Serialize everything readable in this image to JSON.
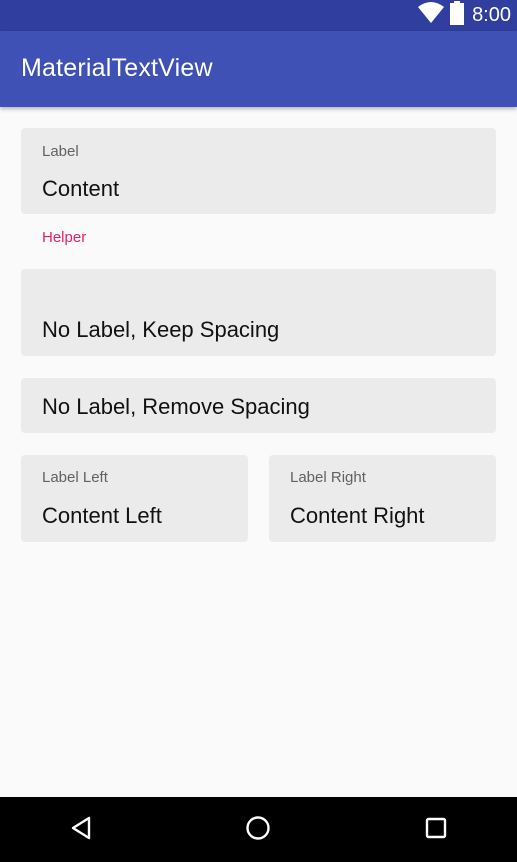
{
  "status_bar": {
    "time": "8:00",
    "icons": [
      "wifi-icon",
      "battery-icon"
    ],
    "color": "#303f9f"
  },
  "app_bar": {
    "title": "MaterialTextView",
    "color": "#3f51b5"
  },
  "fields": [
    {
      "label": "Label",
      "content": "Content",
      "helper": "Helper"
    },
    {
      "label": "",
      "content": "No Label, Keep Spacing"
    },
    {
      "content": "No Label, Remove Spacing"
    },
    {
      "label": "Label Left",
      "content": "Content Left"
    },
    {
      "label": "Label Right",
      "content": "Content Right"
    }
  ],
  "colors": {
    "field_background": "#ebebeb",
    "helper_text": "#e91e63",
    "label_text": "#616161"
  },
  "nav_bar": {
    "buttons": [
      "back-icon",
      "home-icon",
      "recents-icon"
    ]
  }
}
